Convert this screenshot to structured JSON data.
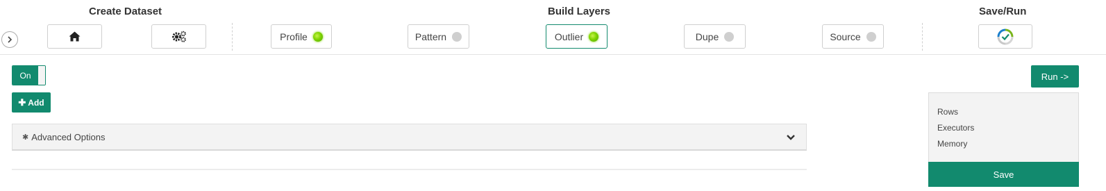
{
  "wizard": {
    "create_title": "Create Dataset",
    "build_title": "Build Layers",
    "save_title": "Save/Run",
    "steps": [
      {
        "label": "Profile",
        "status": "on"
      },
      {
        "label": "Pattern",
        "status": "off"
      },
      {
        "label": "Outlier",
        "status": "on",
        "active": true
      },
      {
        "label": "Dupe",
        "status": "off"
      },
      {
        "label": "Source",
        "status": "off"
      }
    ]
  },
  "toggle": {
    "label": "On",
    "state": "on"
  },
  "add_button": {
    "label": "Add"
  },
  "advanced": {
    "label": "Advanced Options"
  },
  "run_button": {
    "label": "Run ->"
  },
  "side_panel": {
    "items": [
      "Rows",
      "Executors",
      "Memory"
    ],
    "save_label": "Save"
  },
  "colors": {
    "accent": "#128a6e",
    "status_on": "#7fd400",
    "status_off": "#cfcfcf",
    "progress_green": "#7ab51d",
    "progress_blue": "#1b7fcc"
  }
}
